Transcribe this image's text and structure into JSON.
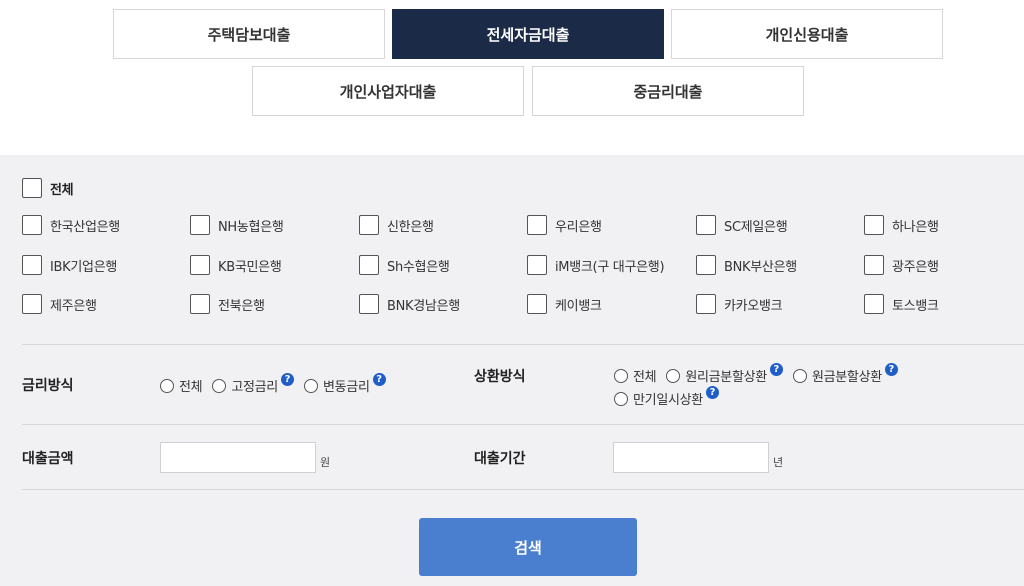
{
  "loan_tabs": [
    {
      "label": "주택담보대출"
    },
    {
      "label": "전세자금대출"
    },
    {
      "label": "개인신용대출"
    },
    {
      "label": "개인사업자대출"
    },
    {
      "label": "중금리대출"
    }
  ],
  "active_tab": "전세자금대출",
  "banks": {
    "all_label": "전체",
    "rows": [
      [
        "한국산업은행",
        "NH농협은행",
        "신한은행",
        "우리은행",
        "SC제일은행",
        "하나은행"
      ],
      [
        "IBK기업은행",
        "KB국민은행",
        "Sh수협은행",
        "iM뱅크(구 대구은행)",
        "BNK부산은행",
        "광주은행"
      ],
      [
        "제주은행",
        "전북은행",
        "BNK경남은행",
        "케이뱅크",
        "카카오뱅크",
        "토스뱅크"
      ]
    ]
  },
  "rate_type": {
    "label": "금리방식",
    "options": [
      "전체",
      "고정금리",
      "변동금리"
    ]
  },
  "repayment": {
    "label": "상환방식",
    "options": [
      "전체",
      "원리금분할상환",
      "원금분할상환",
      "만기일시상환"
    ]
  },
  "amount": {
    "label": "대출금액",
    "value": "",
    "unit": "원"
  },
  "period": {
    "label": "대출기간",
    "value": "",
    "unit": "년"
  },
  "help_glyph": "?",
  "search_label": "검색",
  "colors": {
    "active_tab_bg": "#1b2a47",
    "panel_bg": "#f1f1f4",
    "search_button": "#4a7fd0",
    "help_icon": "#1f5ec8"
  }
}
